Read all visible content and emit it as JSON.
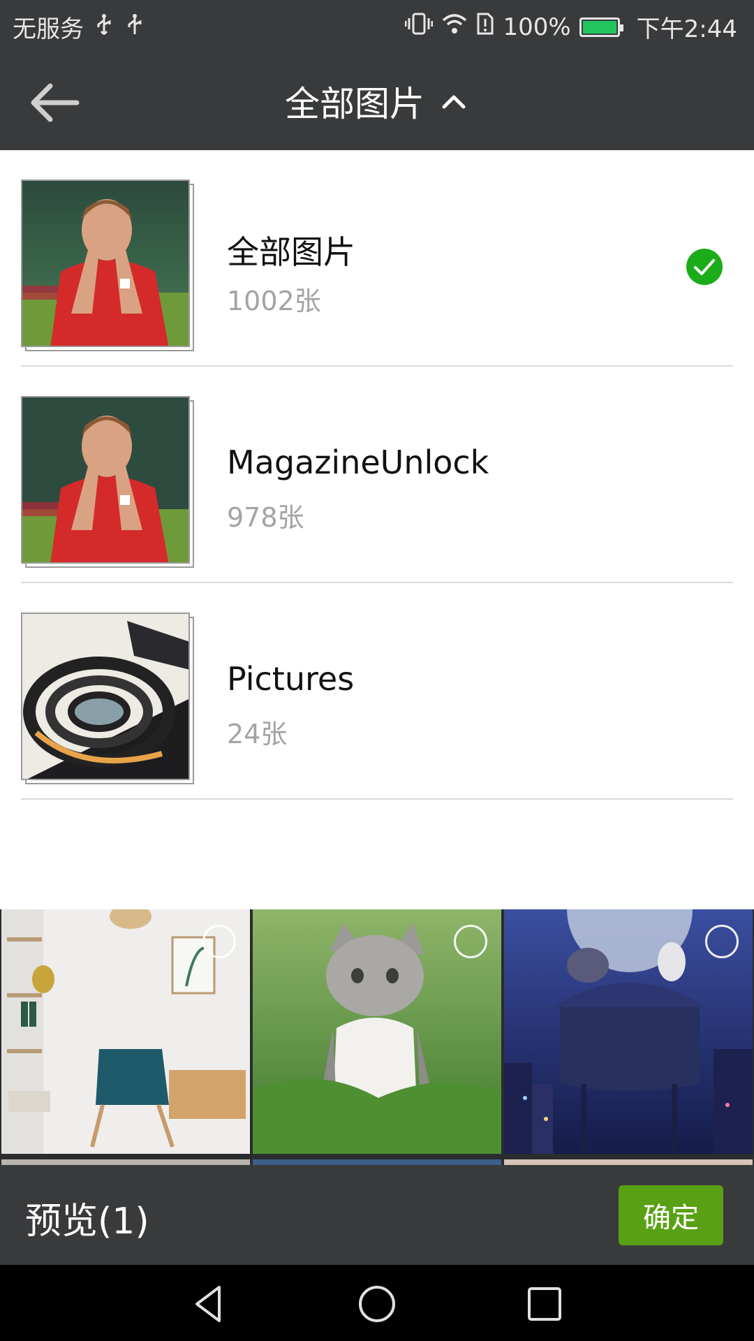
{
  "status_bar": {
    "carrier": "无服务",
    "battery": "100%",
    "time": "下午2:44",
    "battery_color": "#22c55e"
  },
  "header": {
    "title": "全部图片"
  },
  "albums": [
    {
      "name": "全部图片",
      "count": "1002张",
      "selected": true
    },
    {
      "name": "MagazineUnlock",
      "count": "978张",
      "selected": false
    },
    {
      "name": "Pictures",
      "count": "24张",
      "selected": false
    }
  ],
  "footer": {
    "preview_label": "预览(1)",
    "confirm_label": "确定",
    "confirm_color": "#59a114"
  },
  "colors": {
    "bar_background": "#393a3c",
    "check_green": "#1aad19"
  }
}
